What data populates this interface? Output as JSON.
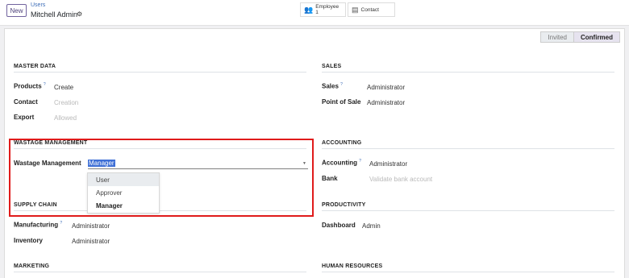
{
  "control_panel": {
    "new_label": "New",
    "breadcrumb_parent": "Users",
    "breadcrumb_current": "Mitchell Admin",
    "stat_employee_label": "Employee",
    "stat_employee_count": "1",
    "stat_contact_label": "Contact"
  },
  "statusbar": {
    "invited": "Invited",
    "confirmed": "Confirmed"
  },
  "master_data": {
    "title": "MASTER DATA",
    "products_label": "Products",
    "products_value": "Create",
    "contact_label": "Contact",
    "contact_value": "Creation",
    "export_label": "Export",
    "export_value": "Allowed"
  },
  "sales": {
    "title": "SALES",
    "sales_label": "Sales",
    "sales_value": "Administrator",
    "pos_label": "Point of Sale",
    "pos_value": "Administrator"
  },
  "wastage": {
    "title": "WASTAGE MANAGEMENT",
    "label": "Wastage Management",
    "value": "Manager",
    "options": [
      "User",
      "Approver",
      "Manager"
    ]
  },
  "accounting": {
    "title": "ACCOUNTING",
    "accounting_label": "Accounting",
    "accounting_value": "Administrator",
    "bank_label": "Bank",
    "bank_value": "Validate bank account"
  },
  "supply_chain": {
    "title": "SUPPLY CHAIN",
    "manufacturing_label": "Manufacturing",
    "manufacturing_value": "Administrator",
    "inventory_label": "Inventory",
    "inventory_value": "Administrator"
  },
  "productivity": {
    "title": "PRODUCTIVITY",
    "dashboard_label": "Dashboard",
    "dashboard_value": "Admin"
  },
  "marketing": {
    "title": "MARKETING"
  },
  "human_resources": {
    "title": "HUMAN RESOURCES"
  },
  "help_marker": "?",
  "colors": {
    "highlight_frame": "#e01b1b",
    "brand": "#71639e",
    "selection": "#3e6fd6"
  }
}
